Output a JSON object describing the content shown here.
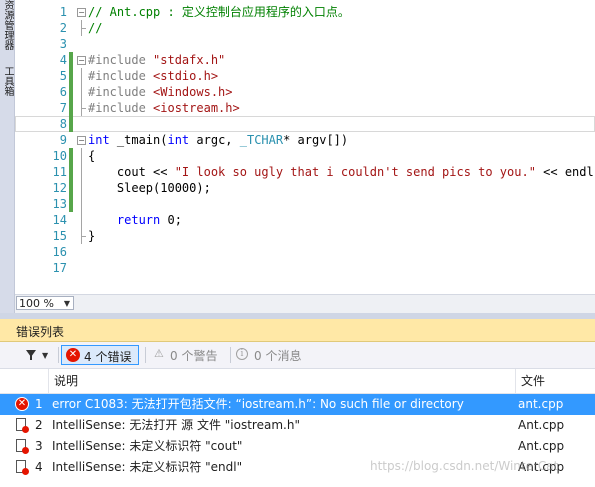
{
  "left_strip": {
    "tab1": "资源管理器",
    "tab2": "工具箱"
  },
  "editor": {
    "lines": [
      {
        "n": "1",
        "green": false,
        "fold": "minus",
        "tokens": [
          {
            "t": "// Ant.cpp : 定义控制台应用程序的入口点。",
            "c": "comment"
          }
        ]
      },
      {
        "n": "2",
        "green": false,
        "fold": "line-end",
        "tokens": [
          {
            "t": "//",
            "c": "comment"
          }
        ]
      },
      {
        "n": "3",
        "green": false,
        "fold": "",
        "tokens": []
      },
      {
        "n": "4",
        "green": true,
        "fold": "minus",
        "tokens": [
          {
            "t": "#include ",
            "c": "pre"
          },
          {
            "t": "\"stdafx.h\"",
            "c": "str"
          }
        ]
      },
      {
        "n": "5",
        "green": true,
        "fold": "line",
        "tokens": [
          {
            "t": "#include ",
            "c": "pre"
          },
          {
            "t": "<stdio.h>",
            "c": "str"
          }
        ]
      },
      {
        "n": "6",
        "green": true,
        "fold": "line",
        "tokens": [
          {
            "t": "#include ",
            "c": "pre"
          },
          {
            "t": "<Windows.h>",
            "c": "str"
          }
        ]
      },
      {
        "n": "7",
        "green": true,
        "fold": "line-end",
        "tokens": [
          {
            "t": "#include ",
            "c": "pre"
          },
          {
            "t": "<iostream.h>",
            "c": "str"
          }
        ]
      },
      {
        "n": "8",
        "green": true,
        "fold": "",
        "current": true,
        "tokens": []
      },
      {
        "n": "9",
        "green": false,
        "fold": "minus",
        "tokens": [
          {
            "t": "int ",
            "c": "kw"
          },
          {
            "t": "_tmain(",
            "c": "plain"
          },
          {
            "t": "int ",
            "c": "kw"
          },
          {
            "t": "argc, ",
            "c": "plain"
          },
          {
            "t": "_TCHAR",
            "c": "type"
          },
          {
            "t": "* argv[])",
            "c": "plain"
          }
        ]
      },
      {
        "n": "10",
        "green": true,
        "fold": "line",
        "tokens": [
          {
            "t": "{",
            "c": "plain"
          }
        ]
      },
      {
        "n": "11",
        "green": true,
        "fold": "line",
        "tokens": [
          {
            "t": "    cout << ",
            "c": "plain"
          },
          {
            "t": "\"I look so ugly that i couldn't send pics to you.\"",
            "c": "str"
          },
          {
            "t": " << endl;",
            "c": "plain"
          }
        ]
      },
      {
        "n": "12",
        "green": true,
        "fold": "line",
        "tokens": [
          {
            "t": "    Sleep(10000);",
            "c": "plain"
          }
        ]
      },
      {
        "n": "13",
        "green": true,
        "fold": "line",
        "tokens": []
      },
      {
        "n": "14",
        "green": false,
        "fold": "line",
        "tokens": [
          {
            "t": "    ",
            "c": "plain"
          },
          {
            "t": "return ",
            "c": "kw"
          },
          {
            "t": "0;",
            "c": "plain"
          }
        ]
      },
      {
        "n": "15",
        "green": false,
        "fold": "line-end",
        "tokens": [
          {
            "t": "}",
            "c": "plain"
          }
        ]
      },
      {
        "n": "16",
        "green": false,
        "fold": "",
        "tokens": []
      },
      {
        "n": "17",
        "green": false,
        "fold": "",
        "tokens": []
      }
    ],
    "zoom": "100 %"
  },
  "error_list": {
    "title": "错误列表",
    "errors_label": "4 个错误",
    "warnings_label": "0 个警告",
    "messages_label": "0 个消息",
    "col_description": "说明",
    "col_file": "文件",
    "rows": [
      {
        "num": "1",
        "icon": "error",
        "desc": "error C1083: 无法打开包括文件: “iostream.h”: No such file or directory",
        "file": "ant.cpp",
        "selected": true
      },
      {
        "num": "2",
        "icon": "intellisense",
        "desc": "IntelliSense:  无法打开 源 文件 \"iostream.h\"",
        "file": "Ant.cpp",
        "selected": false
      },
      {
        "num": "3",
        "icon": "intellisense",
        "desc": "IntelliSense:  未定义标识符 \"cout\"",
        "file": "Ant.cpp",
        "selected": false
      },
      {
        "num": "4",
        "icon": "intellisense",
        "desc": "IntelliSense:  未定义标识符 \"endl\"",
        "file": "Ant.cpp",
        "selected": false
      }
    ]
  },
  "watermark": "https://blog.csdn.net/WinterCat"
}
